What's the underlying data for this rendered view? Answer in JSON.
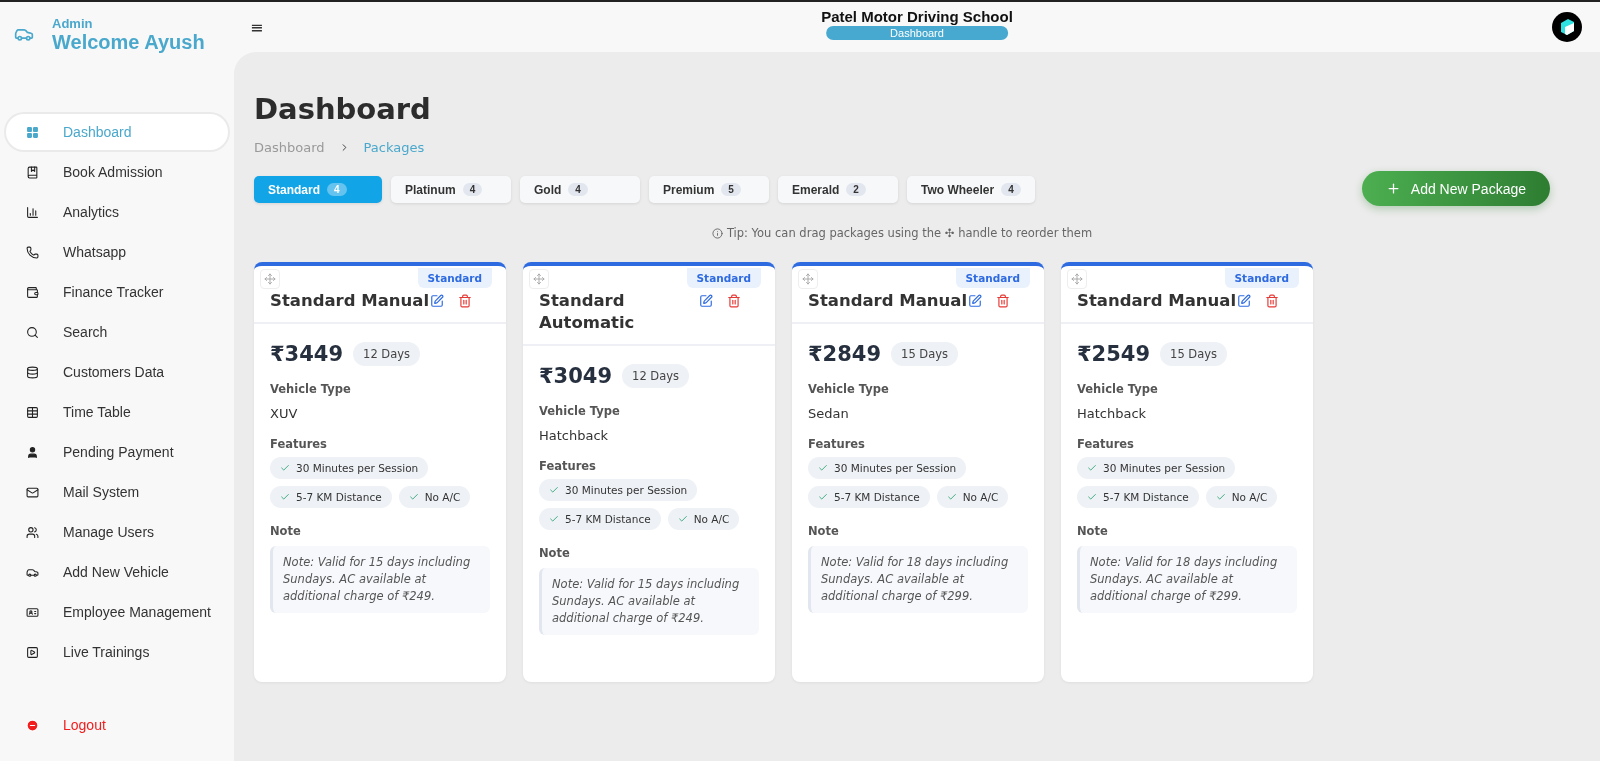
{
  "sidebar": {
    "role": "Admin",
    "welcome": "Welcome Ayush",
    "items": [
      {
        "label": "Dashboard",
        "selected": true
      },
      {
        "label": "Book Admission",
        "selected": false
      },
      {
        "label": "Analytics",
        "selected": false
      },
      {
        "label": "Whatsapp",
        "selected": false
      },
      {
        "label": "Finance Tracker",
        "selected": false
      },
      {
        "label": "Search",
        "selected": false
      },
      {
        "label": "Customers Data",
        "selected": false
      },
      {
        "label": "Time Table",
        "selected": false
      },
      {
        "label": "Pending Payment",
        "selected": false
      },
      {
        "label": "Mail System",
        "selected": false
      },
      {
        "label": "Manage Users",
        "selected": false
      },
      {
        "label": "Add New Vehicle",
        "selected": false
      },
      {
        "label": "Employee Management",
        "selected": false
      },
      {
        "label": "Live Trainings",
        "selected": false
      }
    ],
    "logout": "Logout"
  },
  "header": {
    "menu": "≡",
    "title": "Patel Motor Driving School",
    "badge": "Dashboard"
  },
  "page": {
    "title": "Dashboard",
    "breadcrumb": [
      "Dashboard",
      "Packages"
    ]
  },
  "tabs": [
    {
      "label": "Standard",
      "count": "4",
      "selected": true
    },
    {
      "label": "Platinum",
      "count": "4",
      "selected": false
    },
    {
      "label": "Gold",
      "count": "4",
      "selected": false
    },
    {
      "label": "Premium",
      "count": "5",
      "selected": false
    },
    {
      "label": "Emerald",
      "count": "2",
      "selected": false
    },
    {
      "label": "Two Wheeler",
      "count": "4",
      "selected": false
    }
  ],
  "add_button": "Add New Package",
  "tip": "Tip: You can drag packages using the ✣ handle to reorder them",
  "packages": [
    {
      "tag": "Standard",
      "name": "Standard Manual",
      "price": "₹3449",
      "duration": "12 Days",
      "vehicle_label": "Vehicle Type",
      "vehicle": "XUV",
      "features_label": "Features",
      "features": [
        "30 Minutes per Session",
        "5-7 KM Distance",
        "No A/C"
      ],
      "note_label": "Note",
      "note": "Note: Valid for 15 days including Sundays. AC available at additional charge of ₹249."
    },
    {
      "tag": "Standard",
      "name": "Standard Automatic",
      "price": "₹3049",
      "duration": "12 Days",
      "vehicle_label": "Vehicle Type",
      "vehicle": "Hatchback",
      "features_label": "Features",
      "features": [
        "30 Minutes per Session",
        "5-7 KM Distance",
        "No A/C"
      ],
      "note_label": "Note",
      "note": "Note: Valid for 15 days including Sundays. AC available at additional charge of ₹249."
    },
    {
      "tag": "Standard",
      "name": "Standard Manual",
      "price": "₹2849",
      "duration": "15 Days",
      "vehicle_label": "Vehicle Type",
      "vehicle": "Sedan",
      "features_label": "Features",
      "features": [
        "30 Minutes per Session",
        "5-7 KM Distance",
        "No A/C"
      ],
      "note_label": "Note",
      "note": "Note: Valid for 18 days including Sundays. AC available at additional charge of ₹299."
    },
    {
      "tag": "Standard",
      "name": "Standard Manual",
      "price": "₹2549",
      "duration": "15 Days",
      "vehicle_label": "Vehicle Type",
      "vehicle": "Hatchback",
      "features_label": "Features",
      "features": [
        "30 Minutes per Session",
        "5-7 KM Distance",
        "No A/C"
      ],
      "note_label": "Note",
      "note": "Note: Valid for 18 days including Sundays. AC available at additional charge of ₹299."
    }
  ]
}
